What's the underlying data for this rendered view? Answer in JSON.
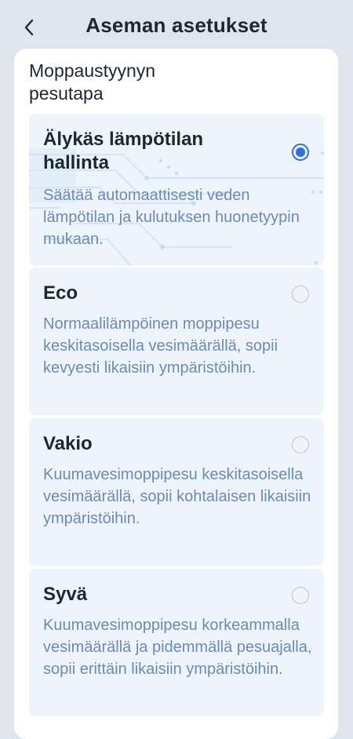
{
  "header": {
    "title": "Aseman asetukset",
    "back_icon": "chevron-left-icon"
  },
  "section": {
    "title": "Moppaustyynyn pesutapa"
  },
  "options": [
    {
      "title": "Älykäs lämpötilan hallinta",
      "description": "Säätää automaattisesti veden lämpötilan ja kulutuksen huonetyypin mukaan.",
      "selected": true
    },
    {
      "title": "Eco",
      "description": "Normaalilämpöinen moppipesu keskitasoisella vesimäärällä, sopii kevyesti likaisiin ympäristöihin.",
      "selected": false
    },
    {
      "title": "Vakio",
      "description": "Kuumavesimoppipesu keskitasoisella vesimäärällä, sopii kohtalaisen likaisiin ympäristöihin.",
      "selected": false
    },
    {
      "title": "Syvä",
      "description": "Kuumavesimoppipesu korkeammalla vesimäärällä ja pidemmällä pesuajalla, sopii erittäin likaisiin ympäristöihin.",
      "selected": false
    }
  ],
  "colors": {
    "accent": "#2f6fe4",
    "background": "#dfe5ee",
    "option_background": "#eef4fb",
    "description_text": "#6d8ab3"
  }
}
